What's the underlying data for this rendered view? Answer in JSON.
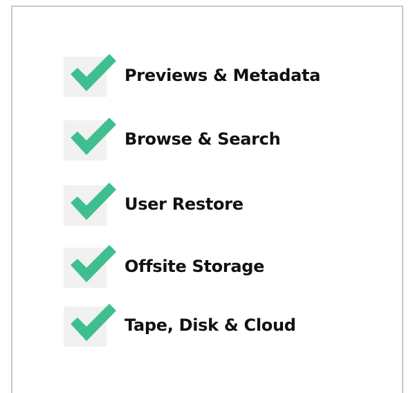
{
  "features": {
    "items": [
      {
        "label": "Previews & Metadata",
        "icon": "checkmark-icon"
      },
      {
        "label": "Browse & Search",
        "icon": "checkmark-icon"
      },
      {
        "label": "User Restore",
        "icon": "checkmark-icon"
      },
      {
        "label": "Offsite Storage",
        "icon": "checkmark-icon"
      },
      {
        "label": "Tape, Disk & Cloud",
        "icon": "checkmark-icon"
      }
    ]
  },
  "colors": {
    "check": "#3fbf8f",
    "check_background": "#f1f1f1",
    "border": "#c8c8c8",
    "text": "#111111"
  }
}
